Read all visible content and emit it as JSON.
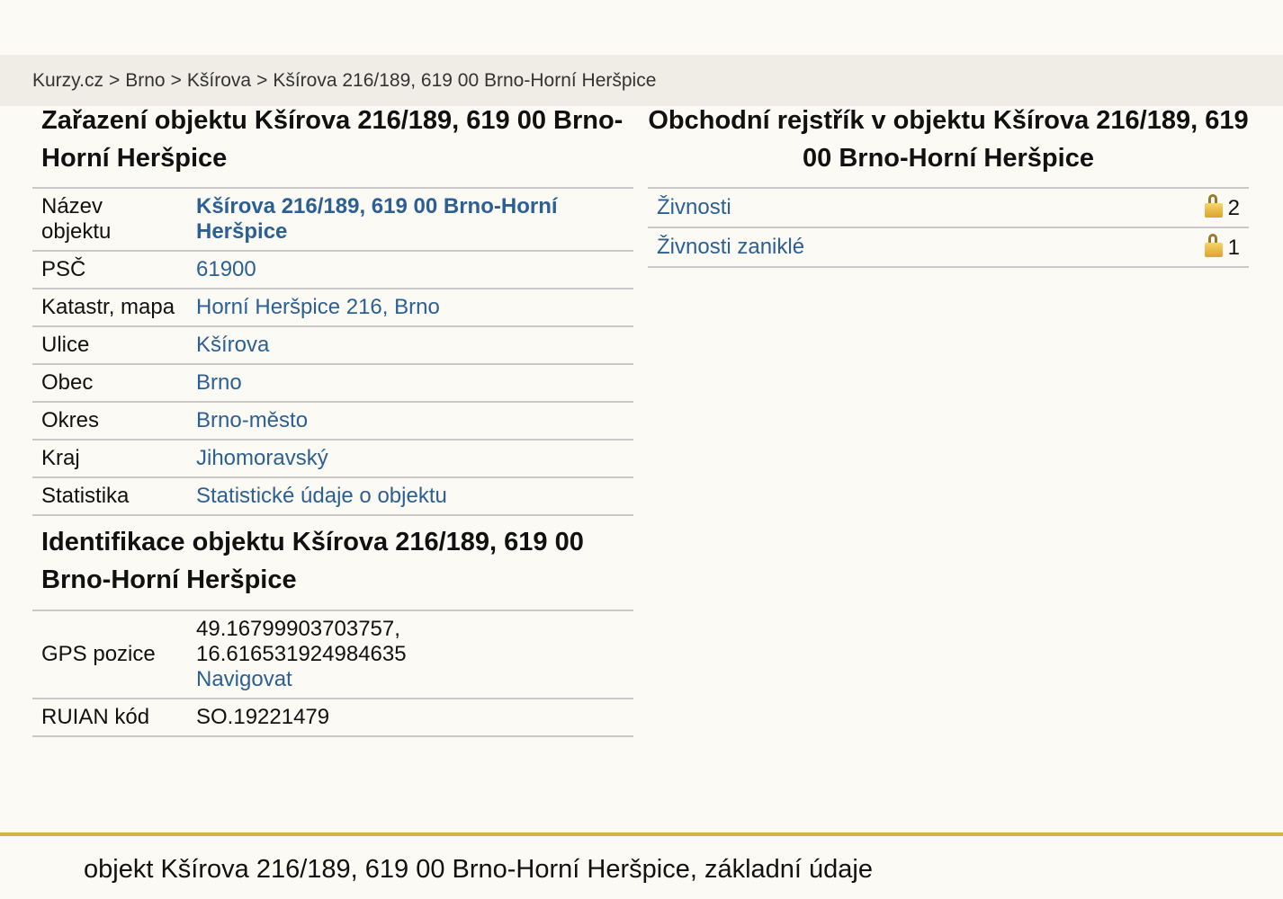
{
  "breadcrumb": {
    "items": [
      "Kurzy.cz",
      "Brno",
      "Kšírova",
      "Kšírova 216/189, 619 00 Brno-Horní Heršpice"
    ],
    "separator": ">"
  },
  "classification": {
    "title": "Zařazení objektu Kšírova 216/189, 619 00 Brno-Horní Heršpice",
    "rows": [
      {
        "label": "Název objektu",
        "value": "Kšírova 216/189, 619 00 Brno-Horní Heršpice"
      },
      {
        "label": "PSČ",
        "value": "61900"
      },
      {
        "label": "Katastr, mapa",
        "value": "Horní Heršpice 216, Brno"
      },
      {
        "label": "Ulice",
        "value": "Kšírova"
      },
      {
        "label": "Obec",
        "value": "Brno"
      },
      {
        "label": "Okres",
        "value": "Brno-město"
      },
      {
        "label": "Kraj",
        "value": "Jihomoravský"
      },
      {
        "label": "Statistika",
        "value": "Statistické údaje o objektu"
      }
    ]
  },
  "identification": {
    "title": "Identifikace objektu Kšírova 216/189, 619 00 Brno-Horní Heršpice",
    "gps": {
      "label": "GPS pozice",
      "lat": "49.16799903703757,",
      "lon": "16.616531924984635",
      "navigate": "Navigovat"
    },
    "ruian": {
      "label": "RUIAN kód",
      "value": "SO.19221479"
    }
  },
  "registry": {
    "title": "Obchodní rejstřík v objektu Kšírova 216/189, 619 00 Brno-Horní Heršpice",
    "rows": [
      {
        "label": "Živnosti",
        "count": "2",
        "icon": "lock-icon"
      },
      {
        "label": "Živnosti zaniklé",
        "count": "1",
        "icon": "lock-icon"
      }
    ]
  },
  "footer": {
    "text": "objekt Kšírova 216/189, 619 00 Brno-Horní Heršpice, základní údaje"
  },
  "colors": {
    "link": "#2c5f93",
    "breadcrumb_bg": "#efede6",
    "page_bg": "#fbfaf5",
    "footer_border": "#d6b146"
  }
}
